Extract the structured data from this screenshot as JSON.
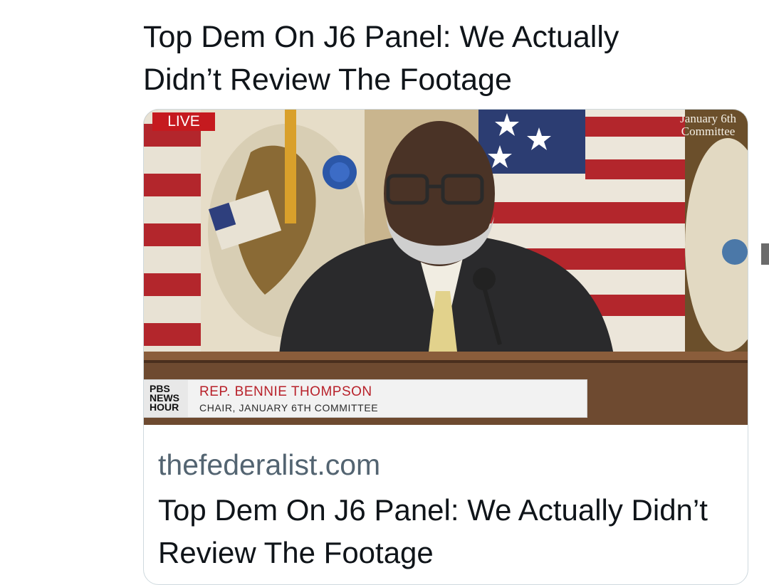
{
  "tweet": {
    "headline": "Top Dem On J6 Panel: We Actually Didn’t Review The Footage"
  },
  "card": {
    "media": {
      "live_badge": "LIVE",
      "watermark_line1": "January 6th",
      "watermark_line2": "Committee",
      "network_line1": "PBS",
      "network_line2": "NEWS",
      "network_line3": "HOUR",
      "lower_third_name": "REP. BENNIE THOMPSON",
      "lower_third_title": "CHAIR, JANUARY 6TH COMMITTEE"
    },
    "domain": "thefederalist.com",
    "title": "Top Dem On J6 Panel: We Actually Didn’t Review The Footage"
  },
  "colors": {
    "live_badge": "#c51a1f",
    "lower_third_name": "#b8212a",
    "domain_text": "#536471",
    "text_primary": "#0f1419",
    "card_border": "#cfd9de"
  }
}
